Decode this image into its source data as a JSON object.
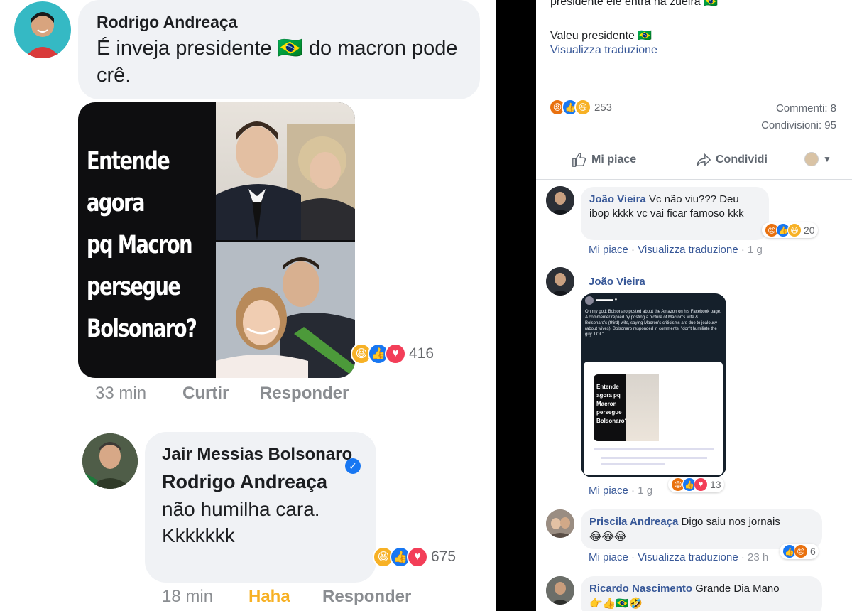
{
  "left_panel": {
    "comment1": {
      "author": "Rodrigo Andreaça",
      "text": "É inveja presidente 🇧🇷 do macron pode crê.",
      "meme_lines": [
        "Entende",
        "agora",
        "pq Macron",
        "persegue",
        "Bolsonaro?"
      ],
      "reaction_count": "416",
      "time": "33 min",
      "like_label": "Curtir",
      "reply_label": "Responder"
    },
    "comment2": {
      "author": "Jair Messias Bolsonaro",
      "mention": "Rodrigo Andreaça",
      "text_line1": "não humilha cara.",
      "text_line2": "Kkkkkkk",
      "reaction_count": "675",
      "time": "18 min",
      "reaction_label": "Haha",
      "reply_label": "Responder"
    }
  },
  "right_panel": {
    "post": {
      "top_line": "presidente ele entra na zueira 🇧🇷",
      "text": "Valeu presidente 🇧🇷",
      "translate_link": "Visualizza traduzione",
      "reaction_count": "253",
      "comments_count": "Commenti: 8",
      "shares_count": "Condivisioni: 95",
      "like_label": "Mi piace",
      "share_label": "Condividi"
    },
    "comments": [
      {
        "author": "João Vieira",
        "text": "Vc não viu??? Deu ibop kkkk vc vai ficar famoso kkk",
        "reaction_count": "20",
        "like": "Mi piace",
        "translate": "Visualizza traduzione",
        "time": "1 g"
      },
      {
        "author": "João Vieira",
        "tweet_text": "Oh my god: Bolsonaro posted about the Amazon on his Facebook page. A commenter replied by posting a picture of Macron's wife & Bolsonaro's (third) wife, saying Macron's criticisms are due to jealousy (about wives). Bolsonaro responded in comments: \"don't humiliate the guy. LOL\"",
        "tweet_meme": "Entende agora pq Macron persegue Bolsonaro?",
        "reaction_count": "13",
        "like": "Mi piace",
        "time": "1 g"
      },
      {
        "author": "Priscila Andreaça",
        "text": "Digo saiu nos jornais",
        "emoji": "😂😂😂",
        "reaction_count": "6",
        "like": "Mi piace",
        "translate": "Visualizza traduzione",
        "time": "23 h"
      },
      {
        "author": "Ricardo Nascimento",
        "text": "Grande Dia Mano",
        "emoji": "👉👍🇧🇷🤣"
      }
    ]
  },
  "colors": {
    "link_blue": "#385898",
    "like_blue": "#1877f2",
    "haha_yellow": "#f7b125",
    "love_red": "#f33e58",
    "angry_orange": "#e9710f",
    "haha_active": "#f7b125"
  }
}
